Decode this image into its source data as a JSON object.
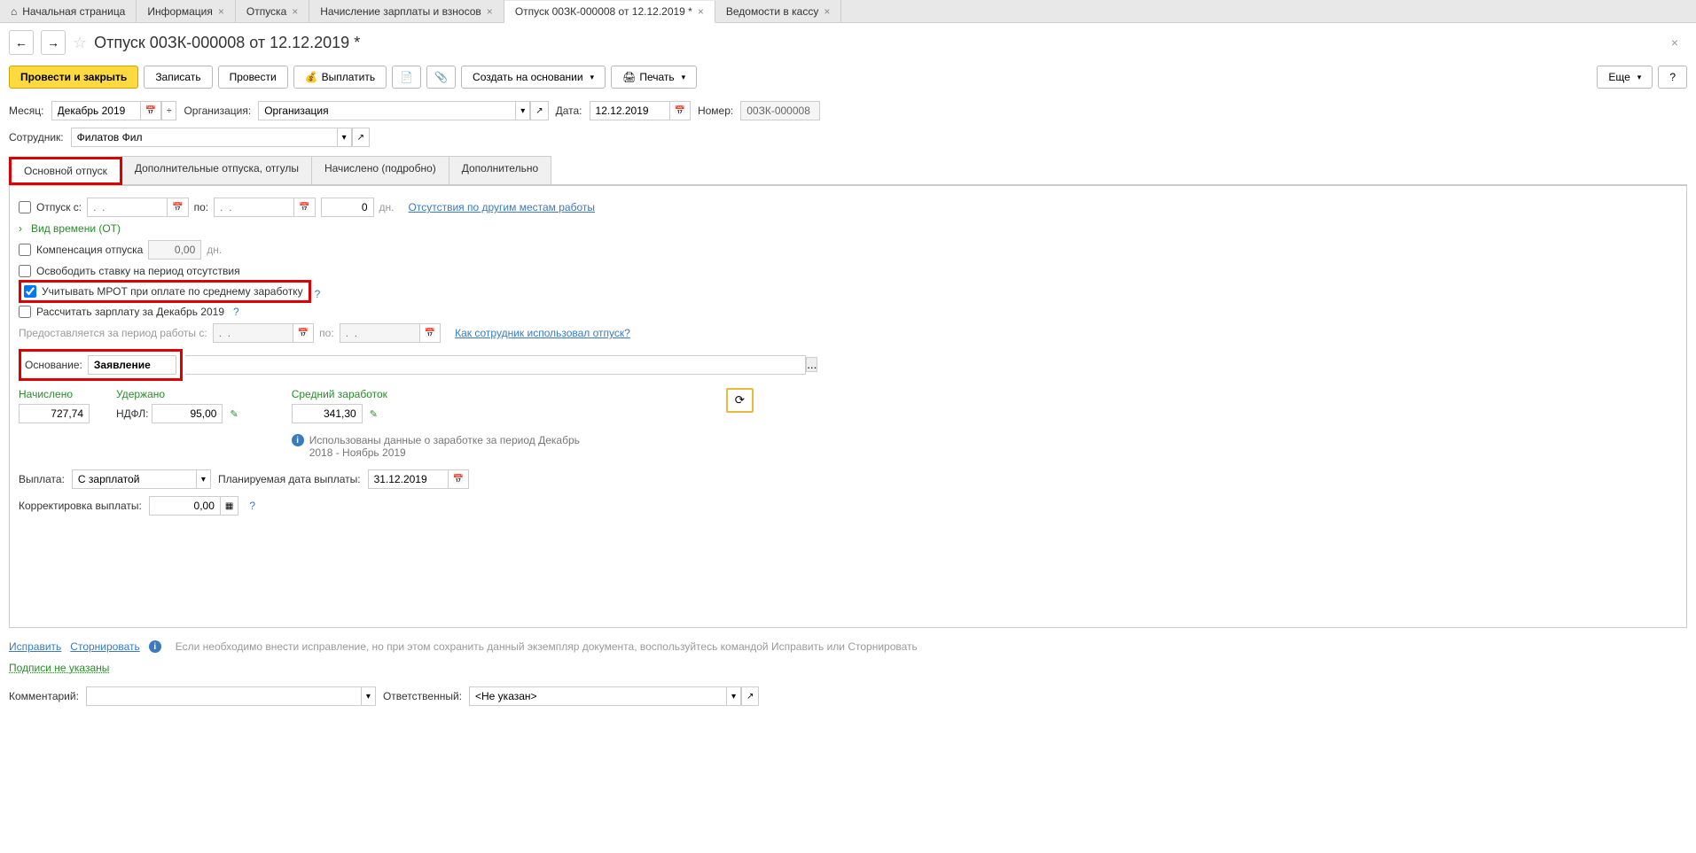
{
  "tabs": [
    {
      "label": "Начальная страница",
      "closable": false,
      "home": true
    },
    {
      "label": "Информация",
      "closable": true
    },
    {
      "label": "Отпуска",
      "closable": true
    },
    {
      "label": "Начисление зарплаты и взносов",
      "closable": true
    },
    {
      "label": "Отпуск 00ЗК-000008 от 12.12.2019 *",
      "closable": true,
      "active": true
    },
    {
      "label": "Ведомости в кассу",
      "closable": true
    }
  ],
  "page_title": "Отпуск 00ЗК-000008 от 12.12.2019 *",
  "toolbar": {
    "post_close": "Провести и закрыть",
    "save": "Записать",
    "post": "Провести",
    "pay": "Выплатить",
    "create_based": "Создать на основании",
    "print": "Печать",
    "more": "Еще",
    "help": "?"
  },
  "header_fields": {
    "month_label": "Месяц:",
    "month_value": "Декабрь 2019",
    "org_label": "Организация:",
    "org_value": "Организация",
    "date_label": "Дата:",
    "date_value": "12.12.2019",
    "number_label": "Номер:",
    "number_value": "00ЗК-000008",
    "employee_label": "Сотрудник:",
    "employee_value": "Филатов Фил"
  },
  "sub_tabs": {
    "main": "Основной отпуск",
    "additional": "Дополнительные отпуска, отгулы",
    "accrued": "Начислено (подробно)",
    "extra": "Дополнительно"
  },
  "main_tab": {
    "vacation_label": "Отпуск  с:",
    "date_placeholder": ".  .",
    "to_label": "по:",
    "days_value": "0",
    "days_unit": "дн.",
    "absence_link": "Отсутствия по другим местам работы",
    "time_type": "Вид времени (ОТ)",
    "compensation_label": "Компенсация отпуска",
    "compensation_value": "0,00",
    "compensation_unit": "дн.",
    "free_rate": "Освободить ставку на период отсутствия",
    "mrot": "Учитывать МРОТ при оплате по среднему заработку",
    "calc_salary": "Рассчитать зарплату за Декабрь 2019",
    "period_label": "Предоставляется за период работы с:",
    "period_to": "по:",
    "usage_link": "Как сотрудник использовал отпуск?",
    "basis_label": "Основание:",
    "basis_value": "Заявление",
    "accrued_label": "Начислено",
    "accrued_value": "727,74",
    "withheld_label": "Удержано",
    "ndfl_label": "НДФЛ:",
    "ndfl_value": "95,00",
    "avg_label": "Средний заработок",
    "avg_value": "341,30",
    "info_text": "Использованы данные о заработке за период Декабрь 2018 - Ноябрь 2019",
    "payment_label": "Выплата:",
    "payment_value": "С зарплатой",
    "planned_date_label": "Планируемая дата выплаты:",
    "planned_date_value": "31.12.2019",
    "correction_label": "Корректировка выплаты:",
    "correction_value": "0,00"
  },
  "footer": {
    "fix_link": "Исправить",
    "reverse_link": "Сторнировать",
    "footer_info": "Если необходимо внести исправление, но при этом сохранить данный экземпляр документа, воспользуйтесь командой Исправить или Сторнировать",
    "signatures": "Подписи не указаны",
    "comment_label": "Комментарий:",
    "responsible_label": "Ответственный:",
    "responsible_value": "<Не указан>"
  }
}
